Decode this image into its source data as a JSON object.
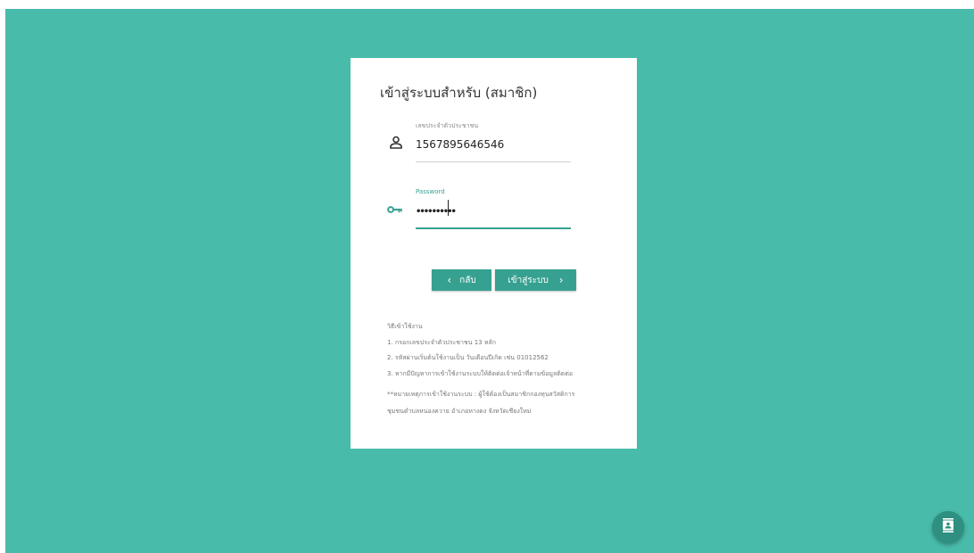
{
  "login": {
    "title": "เข้าสู่ระบบสำหรับ (สมาชิก)",
    "id_field": {
      "label": "เลขประจำตัวประชาชน",
      "value": "1567895646546",
      "icon": "person-icon"
    },
    "password_field": {
      "label": "Password",
      "value": "••••••••••",
      "icon": "key-icon"
    },
    "back_button": "กลับ",
    "login_button": "เข้าสู่ระบบ"
  },
  "help": {
    "heading": "วิธีเข้าใช้งาน",
    "steps": [
      "1. กรอกเลขประจำตัวประชาชน 13 หลัก",
      "2. รหัสผ่านเริ่มต้นใช้งานเป็น วันเดือนปีเกิด เช่น 01012562",
      "3. หากมีปัญหาการเข้าใช้งานระบบให้ติดต่อเจ้าหน้าที่ตามข้อมูลติดต่อ"
    ],
    "note_lines": [
      "**หมายเหตุการเข้าใช้งานระบบ : ผู้ใช้ต้องเป็นสมาชิกกองทุนสวัสดิการ",
      "ชุมชนตำบลหนองควาย อำเภอหางดง จังหวัดเชียงใหม่"
    ]
  },
  "fab": {
    "icon": "contact-book-icon"
  },
  "colors": {
    "background": "#48bbab",
    "accent": "#36a190",
    "card": "#ffffff"
  }
}
